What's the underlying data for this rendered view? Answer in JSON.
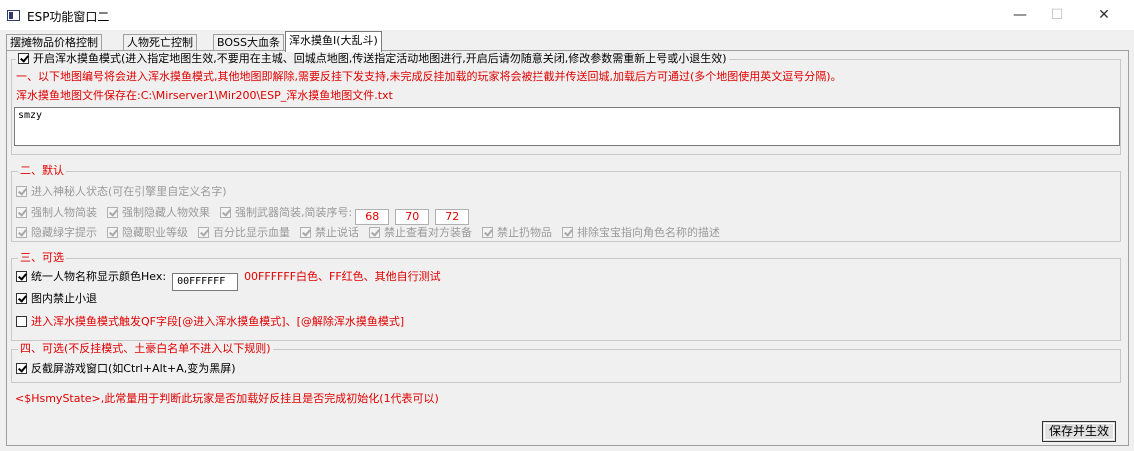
{
  "window": {
    "title": "ESP功能窗口二",
    "minimize": "—",
    "maximize": "☐",
    "close": "✕"
  },
  "tabs": [
    "摆摊物品价格控制",
    "人物死亡控制",
    "BOSS大血条",
    "浑水摸鱼I(大乱斗)"
  ],
  "active_tab": 3,
  "section1": {
    "enable_label": "开启浑水摸鱼模式(进入指定地图生效,不要用在主城、回城点地图,传送指定活动地图进行,开启后请勿随意关闭,修改参数需重新上号或小退生效)",
    "enable_checked": true,
    "note1": "一、以下地图编号将会进入浑水摸鱼模式,其他地图即解除,需要反挂下发支持,未完成反挂加载的玩家将会被拦截并传送回城,加载后方可通过(多个地图使用英文逗号分隔)。",
    "note2": "浑水摸鱼地图文件保存在:C:\\Mirserver1\\Mir200\\ESP_浑水摸鱼地图文件.txt",
    "map_text": "smzy"
  },
  "section2": {
    "legend": "二、默认",
    "row1": [
      {
        "label": "进入神秘人状态(可在引擎里自定义名字)",
        "checked": true
      }
    ],
    "row2": [
      {
        "label": "强制人物简装",
        "checked": true
      },
      {
        "label": "强制隐藏人物效果",
        "checked": true
      },
      {
        "label": "强制武器简装,简装序号:",
        "checked": true
      }
    ],
    "seq_values": [
      "68",
      "70",
      "72"
    ],
    "row3": [
      {
        "label": "隐藏绿字提示",
        "checked": true
      },
      {
        "label": "隐藏职业等级",
        "checked": true
      },
      {
        "label": "百分比显示血量",
        "checked": true
      },
      {
        "label": "禁止说话",
        "checked": true
      },
      {
        "label": "禁止查看对方装备",
        "checked": true
      },
      {
        "label": "禁止扔物品",
        "checked": true
      },
      {
        "label": "排除宝宝指向角色名称的描述",
        "checked": true
      }
    ]
  },
  "section3": {
    "legend": "三、可选",
    "color_label": "统一人物名称显示颜色Hex:",
    "color_checked": true,
    "color_value": "00FFFFFF",
    "color_hint": "00FFFFFF白色、FF红色、其他自行测试",
    "no_logout_label": "图内禁止小退",
    "no_logout_checked": true,
    "qf_label": "进入浑水摸鱼模式触发QF字段[@进入浑水摸鱼模式]、[@解除浑水摸鱼模式]",
    "qf_checked": false
  },
  "section4": {
    "legend": "四、可选(不反挂模式、土豪白名单不进入以下规则)",
    "anti_label": "反截屏游戏窗口(如Ctrl+Alt+A,变为黑屏)",
    "anti_checked": true
  },
  "footer_note": "<$HsmyState>,此常量用于判断此玩家是否加载好反挂且是否完成初始化(1代表可以)",
  "save_label": "保存并生效"
}
